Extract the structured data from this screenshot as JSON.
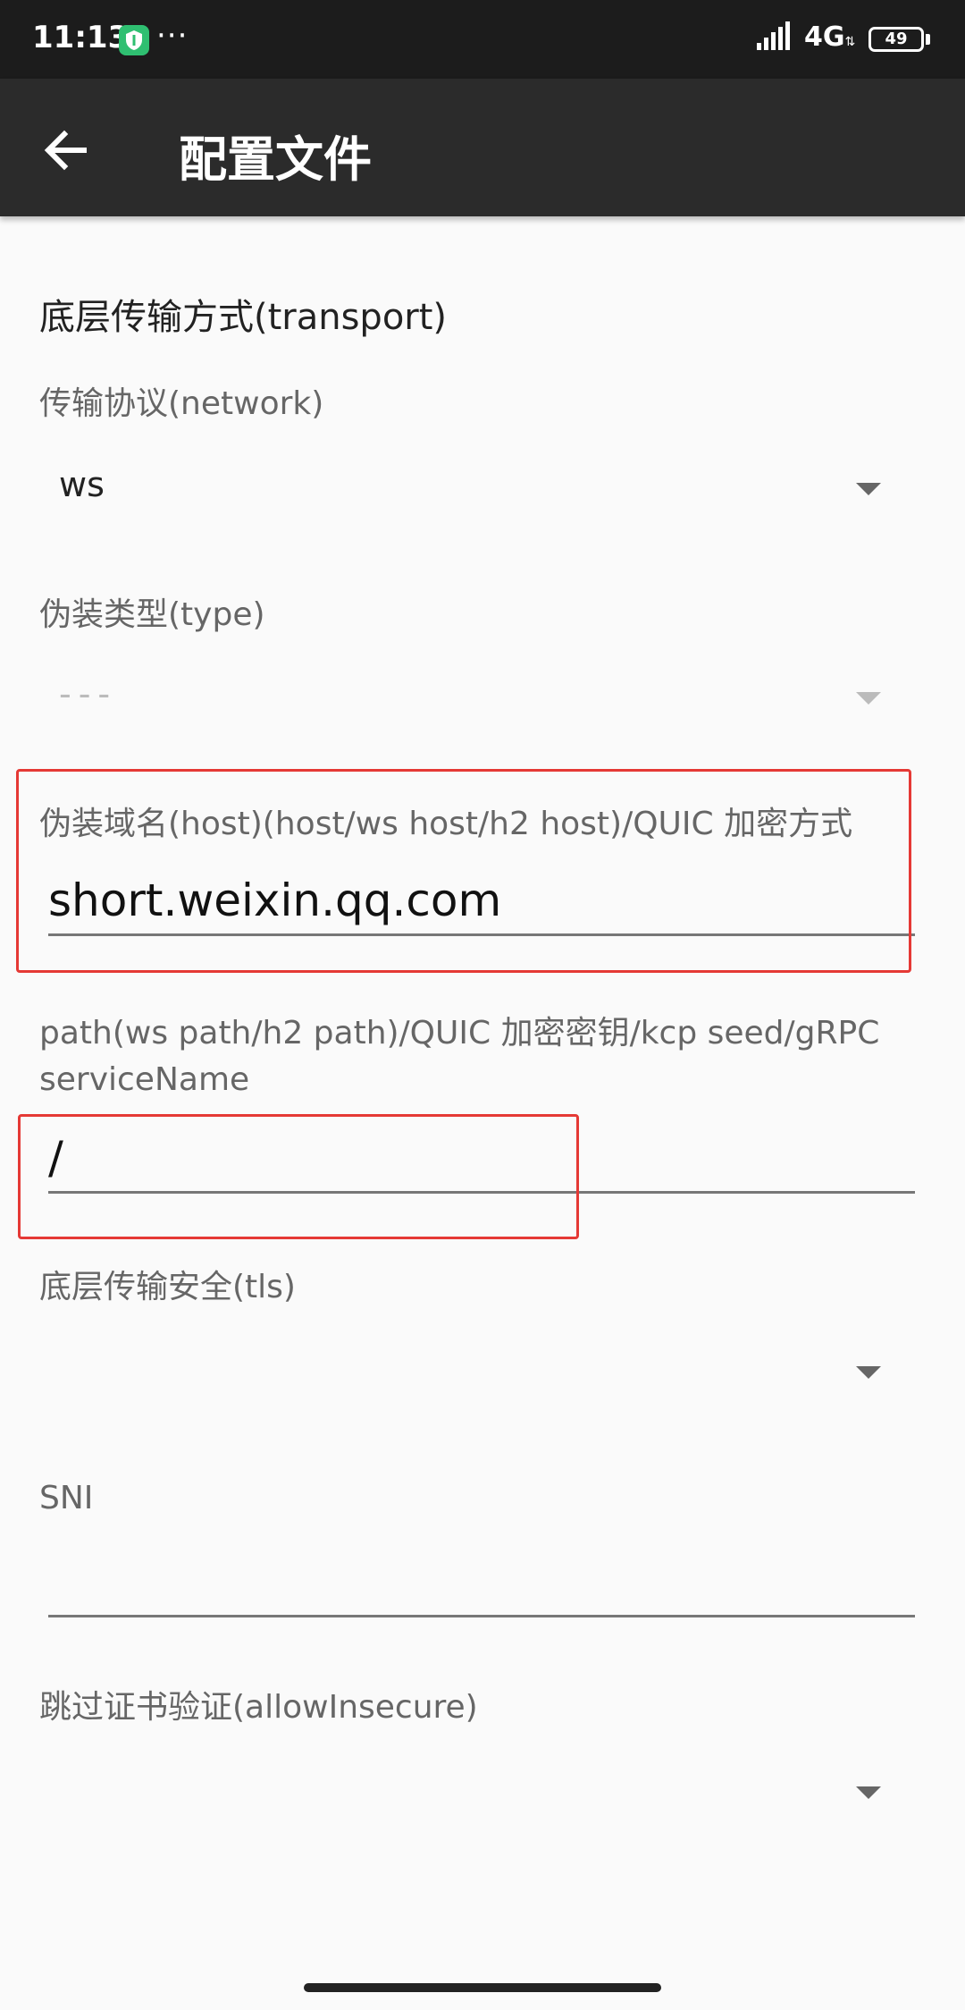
{
  "status": {
    "time": "11:13",
    "dots": "···",
    "network": "4G",
    "battery": "49"
  },
  "appbar": {
    "title": "配置文件"
  },
  "form": {
    "section_title": "底层传输方式(transport)",
    "network": {
      "label": "传输协议(network)",
      "value": "ws"
    },
    "type": {
      "label": "伪装类型(type)",
      "value": "---"
    },
    "host": {
      "label": "伪装域名(host)(host/ws host/h2 host)/QUIC 加密方式",
      "value": "short.weixin.qq.com"
    },
    "path": {
      "label": "path(ws path/h2 path)/QUIC 加密密钥/kcp seed/gRPC serviceName",
      "value": "/"
    },
    "tls": {
      "label": "底层传输安全(tls)",
      "value": ""
    },
    "sni": {
      "label": "SNI",
      "value": ""
    },
    "allow_insecure": {
      "label": "跳过证书验证(allowInsecure)",
      "value": ""
    }
  },
  "colors": {
    "appbar": "#2b2b2b",
    "statusbar": "#1c1c1c",
    "highlight": "#e53935",
    "shield": "#2fbf71"
  }
}
